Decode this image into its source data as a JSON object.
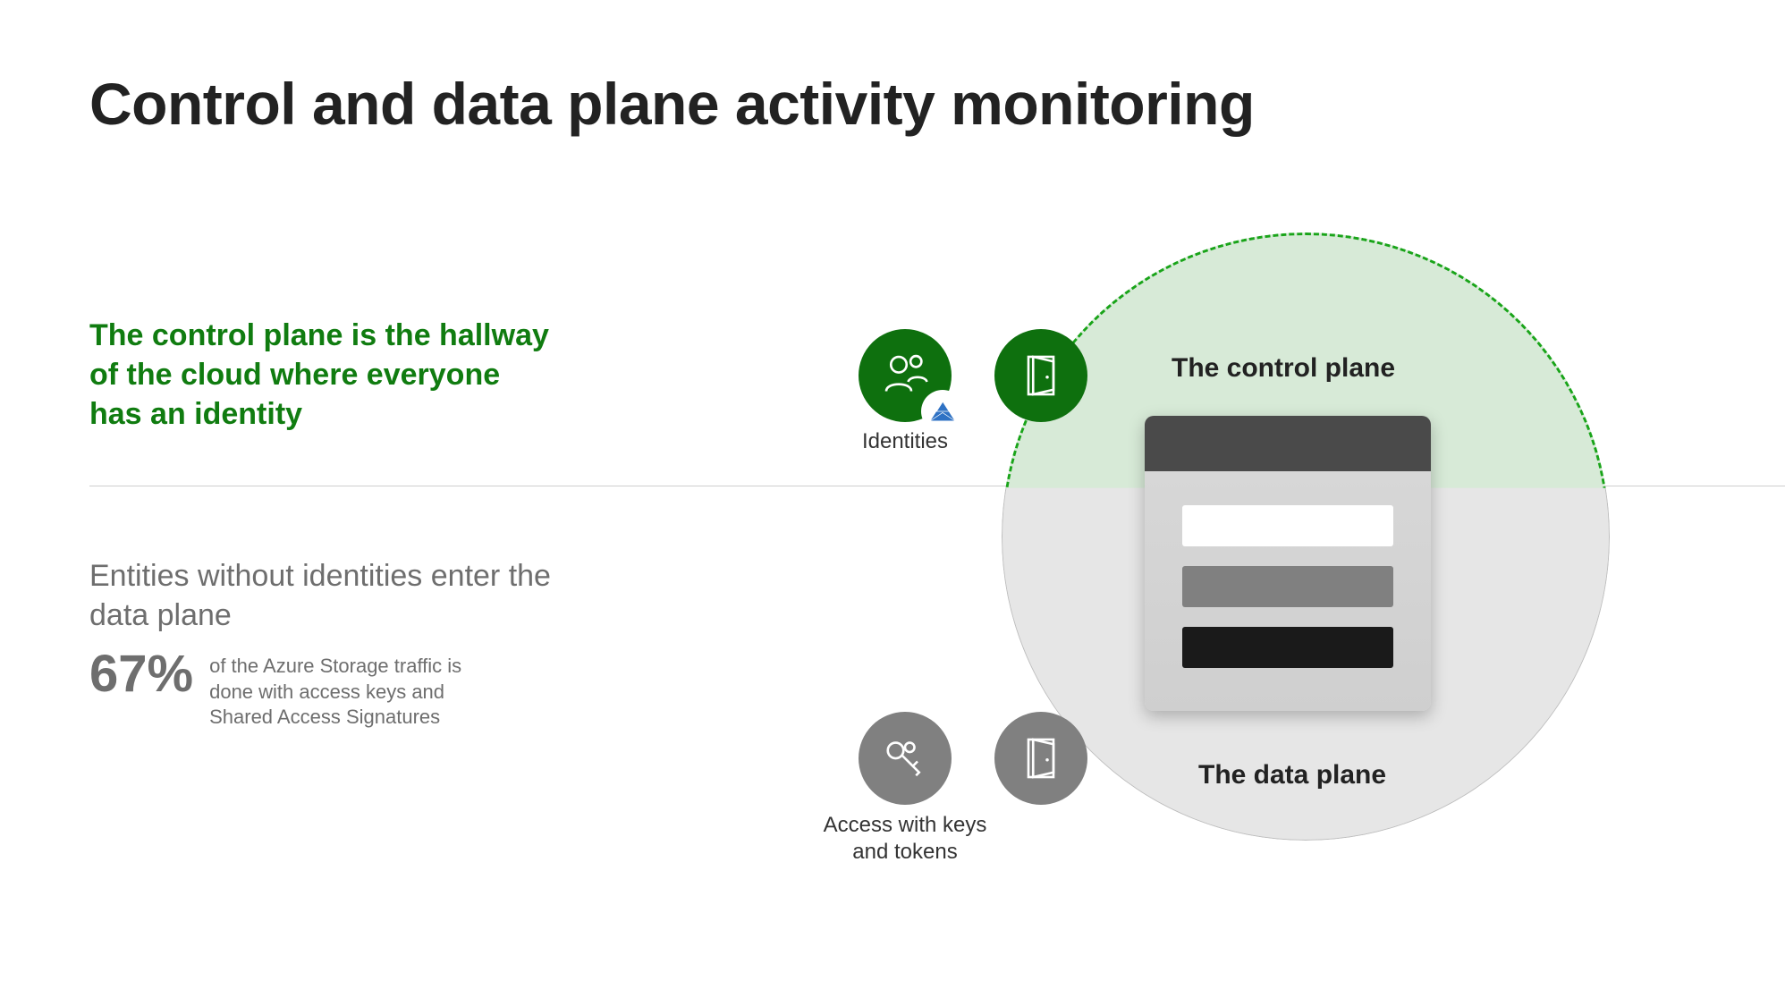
{
  "title": "Control and data plane activity monitoring",
  "control_plane": {
    "heading": "The control plane is the hallway of the cloud where everyone has an identity",
    "label": "The control plane",
    "icon1_name": "identities-icon",
    "icon1_caption": "Identities",
    "door_icon_name": "door-icon"
  },
  "data_plane": {
    "heading": "Entities without identities enter the data plane",
    "label": "The data plane",
    "stat_value": "67%",
    "stat_text": "of the Azure Storage traffic is done with access keys and Shared Access Signatures",
    "keys_icon_name": "key-icon",
    "keys_caption": "Access with keys and tokens",
    "door_icon_name": "door-icon"
  },
  "colors": {
    "accent_green": "#107c10",
    "muted_gray": "#6e6e6e"
  }
}
